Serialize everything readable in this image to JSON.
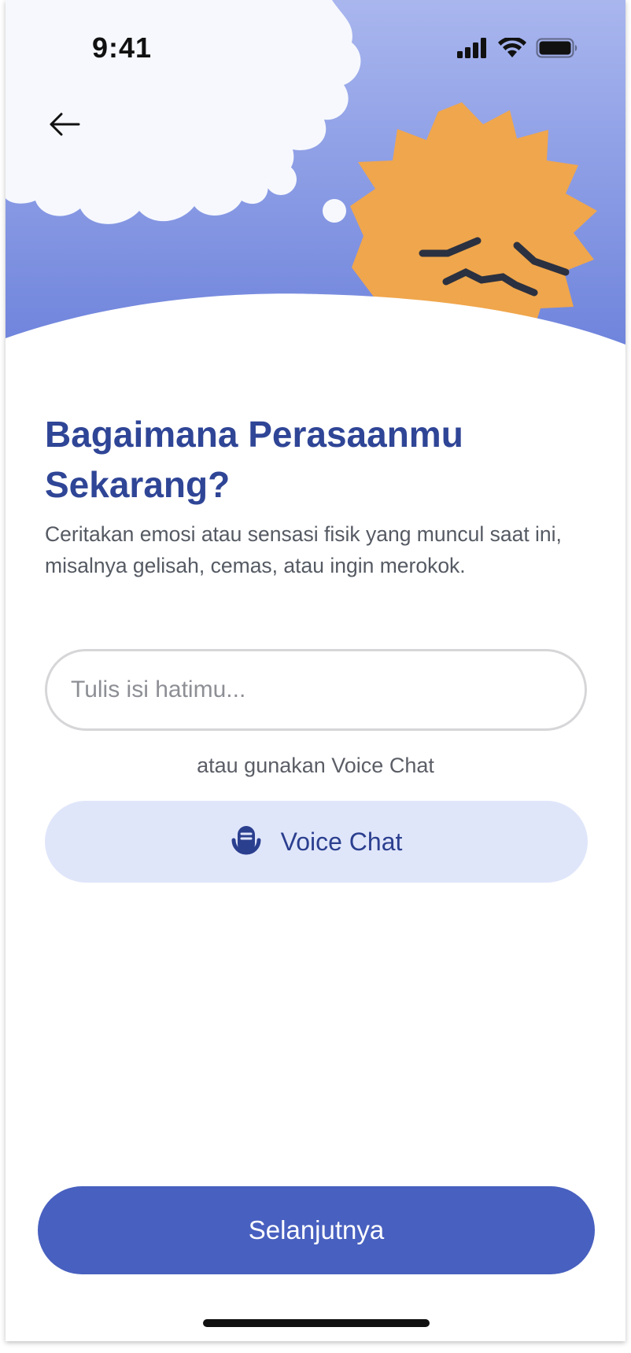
{
  "status_bar": {
    "time": "9:41",
    "icons": [
      "signal-icon",
      "wifi-icon",
      "battery-icon"
    ]
  },
  "header": {
    "back_icon": "arrow-left-icon",
    "illustration": "anxious-sun-with-thought-cloud",
    "colors": {
      "sky": "#7a8ee0",
      "sun": "#f0a64c",
      "cloud": "#f6f8fd"
    }
  },
  "main": {
    "title": "Bagaimana Perasaanmu Sekarang?",
    "subtitle": "Ceritakan emosi atau sensasi fisik yang muncul saat ini, misalnya gelisah, cemas, atau ingin merokok.",
    "input": {
      "value": "",
      "placeholder": "Tulis isi hatimu..."
    },
    "or_text": "atau gunakan Voice Chat",
    "voice_button": {
      "icon": "microphone-icon",
      "label": "Voice Chat"
    }
  },
  "footer": {
    "next_label": "Selanjutnya"
  },
  "colors": {
    "accent": "#4860bf",
    "title": "#2f4596",
    "voice_bg": "#e0e6fa"
  }
}
